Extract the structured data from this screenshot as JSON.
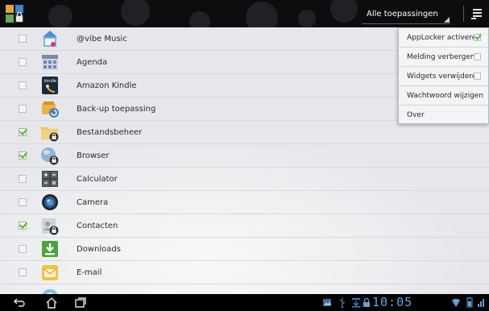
{
  "action_bar": {
    "filter_label": "Alle toepassingen",
    "icons": [
      "applocker-app-icon",
      "caret-icon",
      "overflow-menu-icon"
    ]
  },
  "apps": [
    {
      "name": "@vibe Music",
      "checked": false,
      "icon": "vibe-music-icon"
    },
    {
      "name": "Agenda",
      "checked": false,
      "icon": "calendar-icon"
    },
    {
      "name": "Amazon Kindle",
      "checked": false,
      "icon": "kindle-icon"
    },
    {
      "name": "Back-up toepassing",
      "checked": false,
      "icon": "backup-icon"
    },
    {
      "name": "Bestandsbeheer",
      "checked": true,
      "icon": "file-manager-locked-icon"
    },
    {
      "name": "Browser",
      "checked": true,
      "icon": "browser-locked-icon"
    },
    {
      "name": "Calculator",
      "checked": false,
      "icon": "calculator-icon"
    },
    {
      "name": "Camera",
      "checked": false,
      "icon": "camera-icon"
    },
    {
      "name": "Contacten",
      "checked": true,
      "icon": "contacts-locked-icon"
    },
    {
      "name": "Downloads",
      "checked": false,
      "icon": "downloads-icon"
    },
    {
      "name": "E-mail",
      "checked": false,
      "icon": "email-icon"
    }
  ],
  "menu": {
    "items": [
      {
        "label": "AppLocker activeren",
        "checkbox": true,
        "checked": true
      },
      {
        "label": "Melding verbergen",
        "checkbox": true,
        "checked": false
      },
      {
        "label": "Widgets verwijderen",
        "checkbox": true,
        "checked": false
      },
      {
        "label": "Wachtwoord wijzigen",
        "checkbox": false
      },
      {
        "label": "Over",
        "checkbox": false
      }
    ]
  },
  "system_bar": {
    "time": "10:05",
    "nav_icons": [
      "back-icon",
      "home-icon",
      "recent-apps-icon"
    ],
    "status_icons": [
      "gallery-notification-icon",
      "usb-icon",
      "download-notification-icon",
      "lock-icon",
      "wifi-icon",
      "battery-icon"
    ]
  },
  "colors": {
    "clock": "#64a8dc",
    "check_green": "#5fae3a",
    "action_bar_bg": "#0d0d0f"
  }
}
